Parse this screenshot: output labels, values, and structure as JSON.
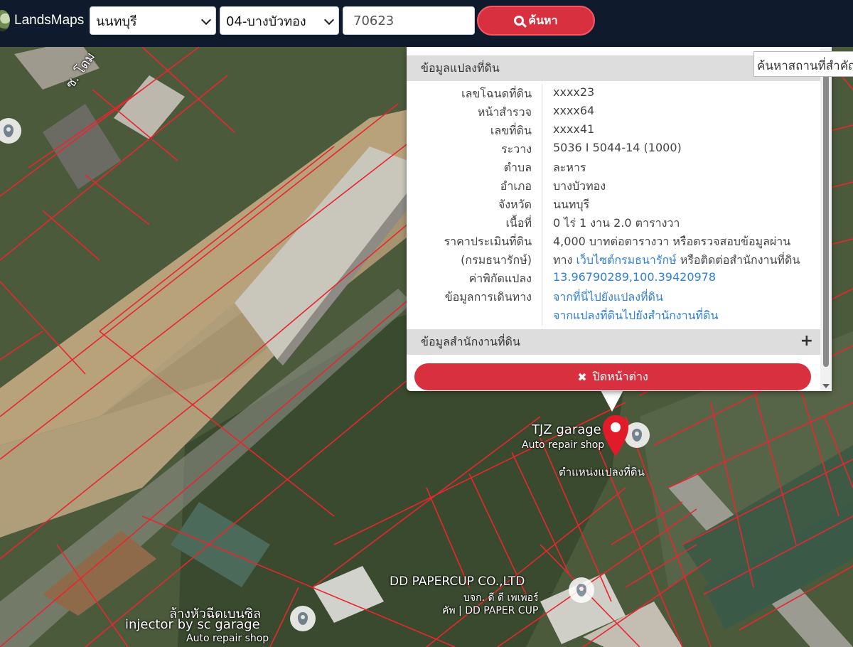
{
  "app": {
    "name": "LandsMaps"
  },
  "search": {
    "province": "นนทบุรี",
    "amphoe": "04-บางบัวทอง",
    "parcel_number": "70623",
    "button_label": "ค้นหา"
  },
  "place_search": {
    "label": "ค้นหาสถานที่สำคัญ"
  },
  "popup": {
    "section_parcel": "ข้อมูลแปลงที่ดิน",
    "section_office": "ข้อมูลสำนักงานที่ดิน",
    "expand_symbol": "+",
    "close_label": "ปิดหน้าต่าง",
    "rows": [
      {
        "label": "เลขโฉนดที่ดิน",
        "value": "xxxx23"
      },
      {
        "label": "หน้าสำรวจ",
        "value": "xxxx64"
      },
      {
        "label": "เลขที่ดิน",
        "value": "xxxx41"
      },
      {
        "label": "ระวาง",
        "value": "5036 I 5044-14 (1000)"
      },
      {
        "label": "ตำบล",
        "value": "ละหาร"
      },
      {
        "label": "อำเภอ",
        "value": "บางบัวทอง"
      },
      {
        "label": "จังหวัด",
        "value": "นนทบุรี"
      },
      {
        "label": "เนื้อที่",
        "value": "0 ไร่ 1 งาน 2.0 ตารางวา"
      },
      {
        "label": "ราคาประเมินที่ดิน",
        "value": "4,000 บาทต่อตารางวา หรือตรวจสอบข้อมูลผ่าน"
      }
    ],
    "price_note": {
      "label": "(กรมธนารักษ์)",
      "prefix": "ทาง",
      "link": "เว็บไซต์กรมธนารักษ์",
      "suffix": "หรือติดต่อสำนักงานที่ดิน"
    },
    "coords": {
      "label": "ค่าพิกัดแปลง",
      "value": "13.96790289,100.39420978"
    },
    "travel": {
      "label": "ข้อมูลการเดินทาง",
      "link_to": "จากที่นี่ไปยังแปลงที่ดิน",
      "link_office": "จากแปลงที่ดินไปยังสำนักงานที่ดิน"
    }
  },
  "map": {
    "labels": {
      "road": "ซ. โดม",
      "tjz_name": "TJZ garage",
      "tjz_type": "Auto repair shop",
      "parcel_marker": "ตำแหน่งแปลงที่ดิน",
      "dd_name": "DD PAPERCUP CO.,LTD",
      "dd_thai": "บจก. ดี ดี เพเพอร์",
      "dd_sub": "คัพ | DD PAPER CUP",
      "sc_thai": "ล้างหัวฉีดเบนซิล",
      "sc_name": "injector by sc garage",
      "sc_type": "Auto repair shop"
    }
  },
  "colors": {
    "topbar": "#0f1a2c",
    "accent": "#d8303f",
    "link": "#2f7fd8",
    "parcel_lines": "#e8262f"
  }
}
